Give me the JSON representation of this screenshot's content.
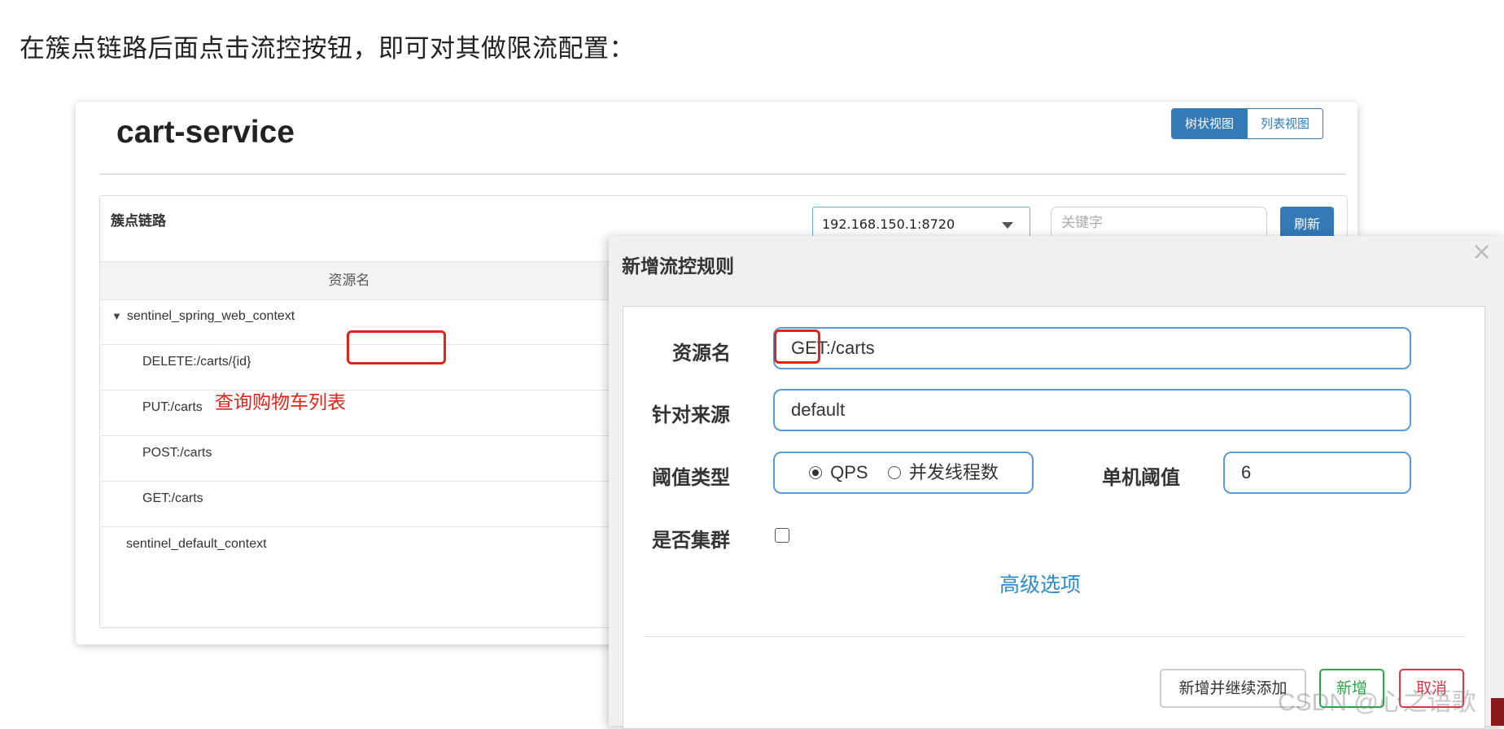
{
  "intro_text": "在簇点链路后面点击流控按钮，即可对其做限流配置：",
  "app": {
    "title": "cart-service",
    "view_tabs": [
      "树状视图",
      "列表视图"
    ]
  },
  "panel": {
    "title": "簇点链路",
    "machine_select": "192.168.150.1:8720",
    "keyword_placeholder": "关键字",
    "refresh_label": "刷新",
    "column_header": "资源名",
    "rows": [
      "sentinel_spring_web_context",
      "DELETE:/carts/{id}",
      "PUT:/carts",
      "POST:/carts",
      "GET:/carts",
      "sentinel_default_context"
    ],
    "annotation": "查询购物车列表"
  },
  "modal": {
    "title": "新增流控规则",
    "close_glyph": "×",
    "resource_label": "资源名",
    "resource_value": "GET:/carts",
    "origin_label": "针对来源",
    "origin_value": "default",
    "threshold_type_label": "阈值类型",
    "option_qps": "QPS",
    "option_threads": "并发线程数",
    "qps_selected": true,
    "single_threshold_label": "单机阈值",
    "single_threshold_value": "6",
    "cluster_label": "是否集群",
    "cluster_checked": false,
    "advanced_link": "高级选项",
    "buttons": {
      "add_continue": "新增并继续添加",
      "add": "新增",
      "cancel": "取消"
    }
  },
  "watermark": "CSDN @心之语歌",
  "colors": {
    "primary": "#337ab7",
    "annotation_red": "#e2231a",
    "link_blue": "#2a8bd1",
    "success_green": "#28a745",
    "danger_red": "#dc3545"
  }
}
